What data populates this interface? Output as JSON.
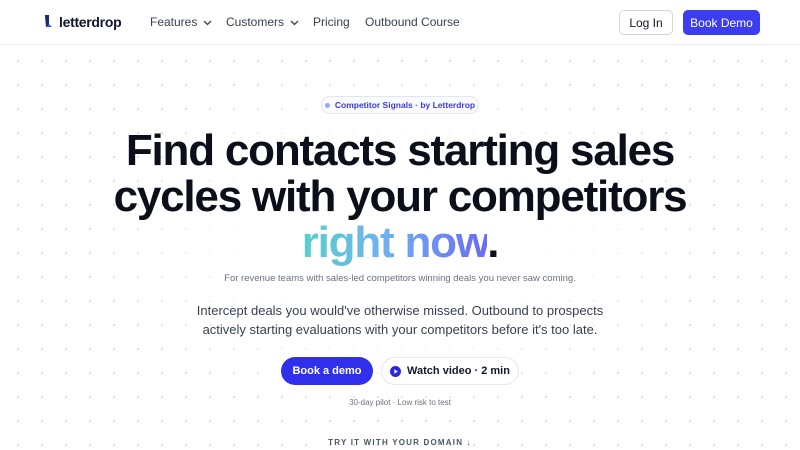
{
  "nav": {
    "brand": "letterdrop",
    "items": [
      {
        "label": "Features",
        "dropdown": true
      },
      {
        "label": "Customers",
        "dropdown": true
      },
      {
        "label": "Pricing",
        "dropdown": false
      },
      {
        "label": "Outbound Course",
        "dropdown": false
      }
    ],
    "login_label": "Log In",
    "book_demo_label": "Book Demo"
  },
  "hero": {
    "badge": "Competitor Signals · by Letterdrop",
    "headline_line1": "Find contacts starting sales",
    "headline_line2": "cycles with your competitors",
    "headline_highlight": "right now",
    "headline_period": ".",
    "subheading": "For revenue teams with sales-led competitors winning deals you never saw coming.",
    "description_line1": "Intercept deals you would've otherwise missed. Outbound to prospects",
    "description_line2": "actively starting evaluations with your competitors before it's too late.",
    "primary_cta": "Book a demo",
    "secondary_cta": "Watch video · 2 min",
    "note": "30-day pilot · Low risk to test",
    "try_label": "TRY IT WITH YOUR DOMAIN ↓"
  },
  "colors": {
    "accent": "#3d3df0",
    "gradient_start": "#5ad1c8",
    "gradient_end": "#6a6cf2",
    "heading": "#0b0f19"
  },
  "icons": [
    "letterdrop-logo-icon",
    "chevron-down-icon",
    "play-icon"
  ]
}
